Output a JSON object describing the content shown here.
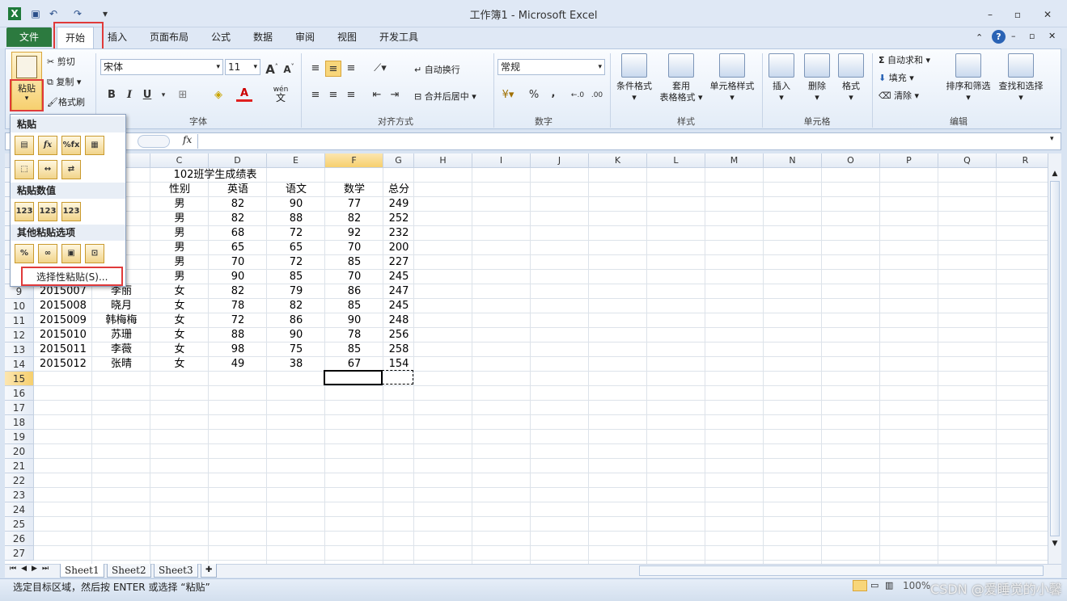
{
  "window": {
    "title": "工作簿1 - Microsoft Excel"
  },
  "tabs": [
    "开始",
    "插入",
    "页面布局",
    "公式",
    "数据",
    "审阅",
    "视图",
    "开发工具"
  ],
  "file_tab": "文件",
  "ribbon": {
    "clipboard": {
      "paste": "粘贴",
      "cut": "剪切",
      "copy": "复制",
      "format_painter": "格式刷"
    },
    "font": {
      "name": "宋体",
      "size": "11",
      "label": "字体",
      "bold": "B",
      "italic": "I",
      "underline": "U",
      "font_color": "A",
      "wen": "wén",
      "wen_char": "文"
    },
    "alignment": {
      "wrap": "自动换行",
      "merge": "合并后居中",
      "label": "对齐方式"
    },
    "number": {
      "format": "常规",
      "label": "数字",
      "percent": "%",
      "comma": ","
    },
    "styles": {
      "cond": "条件格式",
      "table1": "套用",
      "table2": "表格格式",
      "cell": "单元格样式",
      "label": "样式"
    },
    "cells": {
      "insert": "插入",
      "delete": "删除",
      "format": "格式",
      "label": "单元格"
    },
    "editing": {
      "autosum": "自动求和",
      "fill": "填充",
      "clear": "清除",
      "sort": "排序和筛选",
      "find": "查找和选择",
      "label": "编辑"
    }
  },
  "formula_bar": {
    "fx": "fx"
  },
  "paste_menu": {
    "h1": "粘贴",
    "h2": "粘贴数值",
    "h3": "其他粘贴选项",
    "special": "选择性粘贴(S)...",
    "v1": "123",
    "v2": "123",
    "v3": "123"
  },
  "columns": [
    "A",
    "B",
    "C",
    "D",
    "E",
    "F",
    "G",
    "H",
    "I",
    "J",
    "K",
    "L",
    "M",
    "N",
    "O",
    "P",
    "Q",
    "R"
  ],
  "rows": [
    "1",
    "2",
    "3",
    "4",
    "5",
    "6",
    "7",
    "8",
    "9",
    "10",
    "11",
    "12",
    "13",
    "14",
    "15",
    "16",
    "17",
    "18",
    "19",
    "20",
    "21",
    "22",
    "23",
    "24",
    "25",
    "26",
    "27"
  ],
  "sheet": {
    "title": "102班学生成绩表",
    "header": [
      "名",
      "性别",
      "英语",
      "语文",
      "数学",
      "总分"
    ],
    "partial_names": [
      "山",
      "强",
      "磊",
      "明",
      "四",
      "三"
    ],
    "data": [
      [
        "",
        "",
        "男",
        "82",
        "90",
        "77",
        "249"
      ],
      [
        "",
        "",
        "男",
        "82",
        "88",
        "82",
        "252"
      ],
      [
        "",
        "",
        "男",
        "68",
        "72",
        "92",
        "232"
      ],
      [
        "",
        "",
        "男",
        "65",
        "65",
        "70",
        "200"
      ],
      [
        "",
        "",
        "男",
        "70",
        "72",
        "85",
        "227"
      ],
      [
        "",
        "",
        "男",
        "90",
        "85",
        "70",
        "245"
      ],
      [
        "2015007",
        "李丽",
        "女",
        "82",
        "79",
        "86",
        "247"
      ],
      [
        "2015008",
        "晓月",
        "女",
        "78",
        "82",
        "85",
        "245"
      ],
      [
        "2015009",
        "韩梅梅",
        "女",
        "72",
        "86",
        "90",
        "248"
      ],
      [
        "2015010",
        "苏珊",
        "女",
        "88",
        "90",
        "78",
        "256"
      ],
      [
        "2015011",
        "李薇",
        "女",
        "98",
        "75",
        "85",
        "258"
      ],
      [
        "2015012",
        "张晴",
        "女",
        "49",
        "38",
        "67",
        "154"
      ]
    ]
  },
  "sheet_tabs": [
    "Sheet1",
    "Sheet2",
    "Sheet3"
  ],
  "status": {
    "text": "选定目标区域，然后按 ENTER 或选择 “粘贴”",
    "zoom": "100%",
    "watermark": "CSDN @爱睡觉的小馨"
  }
}
